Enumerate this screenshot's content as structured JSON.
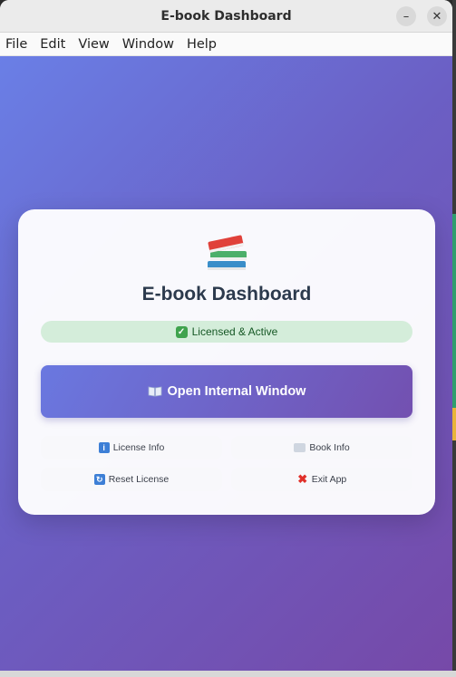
{
  "window": {
    "title": "E-book Dashboard",
    "minimize_glyph": "–",
    "close_glyph": "✕"
  },
  "menu": [
    "File",
    "Edit",
    "View",
    "Window",
    "Help"
  ],
  "card": {
    "icon": "books-icon",
    "title": "E-book Dashboard",
    "status": "Licensed & Active",
    "primary_button": "Open Internal Window",
    "buttons": {
      "license_info": "License Info",
      "book_info": "Book Info",
      "reset_license": "Reset License",
      "exit_app": "Exit App"
    }
  },
  "colors": {
    "gradient_start": "#6a7fe6",
    "gradient_end": "#7649a8",
    "status_bg": "#d4edda",
    "status_text": "#155724",
    "title_text": "#2c3a4d"
  }
}
